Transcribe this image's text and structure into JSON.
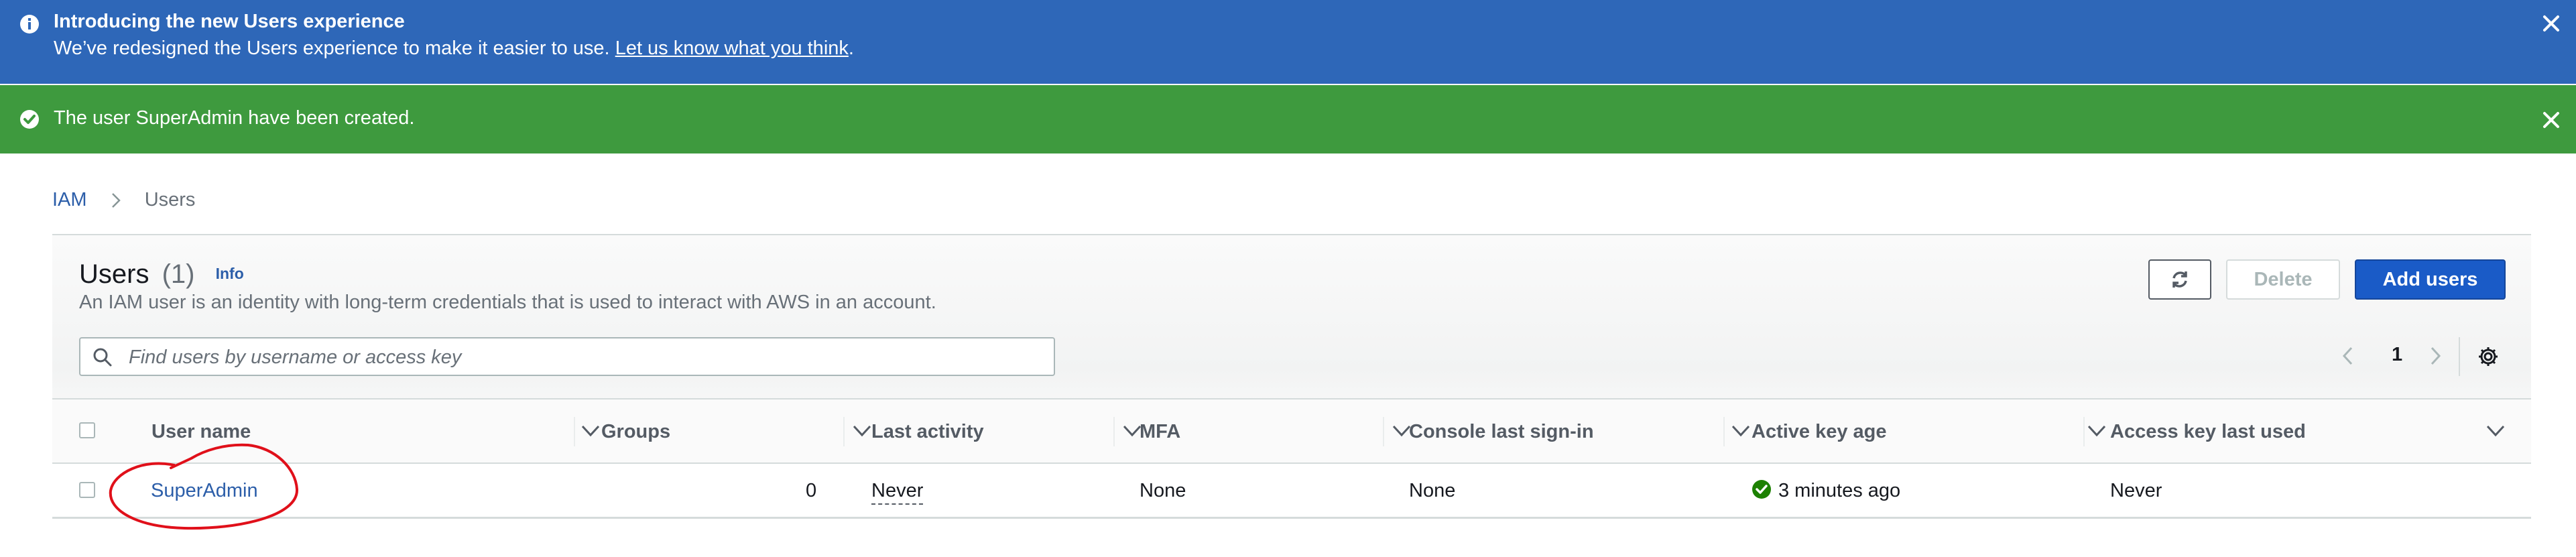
{
  "flash_info": {
    "title": "Introducing the new Users experience",
    "message": "We’ve redesigned the Users experience to make it easier to use. ",
    "link": "Let us know what you think",
    "suffix": "."
  },
  "flash_success": {
    "message": "The user SuperAdmin have been created."
  },
  "breadcrumb": {
    "root": "IAM",
    "current": "Users"
  },
  "users": {
    "title": "Users",
    "count": "(1)",
    "info": "Info",
    "description": "An IAM user is an identity with long-term credentials that is used to interact with AWS in an account.",
    "delete_label": "Delete",
    "add_label": "Add users",
    "search_placeholder": "Find users by username or access key",
    "page": "1"
  },
  "table": {
    "columns": [
      "User name",
      "Groups",
      "Last activity",
      "MFA",
      "Console last sign-in",
      "Active key age",
      "Access key last used"
    ],
    "rows": [
      {
        "user_name": "SuperAdmin",
        "groups": "0",
        "last_activity": "Never",
        "mfa": "None",
        "console_last_sign_in": "None",
        "active_key_age": "3 minutes ago",
        "access_key_last_used": "Never"
      }
    ]
  },
  "colors": {
    "info_banner": "#2e67b8",
    "success_banner": "#3e9a3e",
    "link": "#2c5ea9",
    "primary_button": "#1a5bc7",
    "annotation": "#e0101a"
  },
  "icons": {
    "info": "info-icon",
    "success": "check-circle-icon",
    "close": "close-icon",
    "refresh": "refresh-icon",
    "search": "search-icon",
    "settings": "gear-icon",
    "sort": "caret-down-icon"
  }
}
